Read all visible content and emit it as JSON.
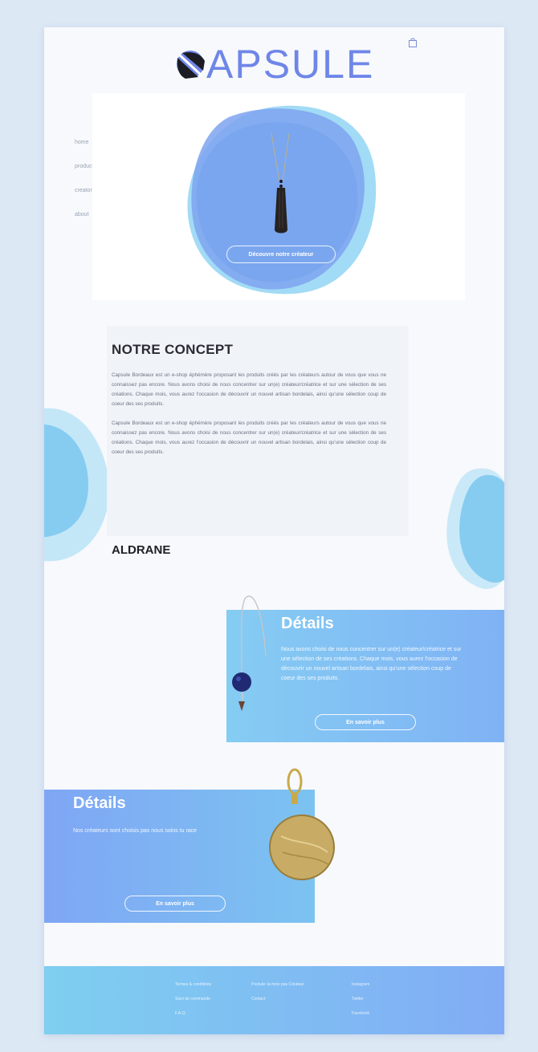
{
  "header": {
    "logo_text": "APSULE",
    "logo_letter": "C",
    "cart_icon": "shopping-bag-icon"
  },
  "nav": {
    "items": [
      {
        "label": "home"
      },
      {
        "label": "products"
      },
      {
        "label": "creators"
      },
      {
        "label": "about"
      }
    ]
  },
  "hero": {
    "button_label": "Découvre notre créateur"
  },
  "concept": {
    "title": "NOTRE CONCEPT",
    "paragraphs": [
      "Capsule Bordeaux est un e-shop éphémère proposant les produits créés par les créateurs autour de vous que vous ne connaissez pas encore. Nous avons choisi de nous concentrer sur un(e) créateur/créatrice et sur une sélection de ses créations. Chaque mois, vous aurez l'occasion de découvrir un nouvel artisan bordelais, ainsi qu'une sélection coup de coeur des ses produits.",
      "Capsule Bordeaux est un e-shop éphémère proposant les produits créés par les créateurs autour de vous que vous ne connaissez pas encore. Nous avons choisi de nous concentrer sur un(e) créateur/créatrice et sur une sélection de ses créations. Chaque mois, vous aurez l'occasion de découvrir un nouvel artisan bordelais, ainsi qu'une sélection coup de coeur des ses produits."
    ]
  },
  "creator": {
    "name": "ALDRANE"
  },
  "card1": {
    "title": "Détails",
    "text": "Nous avons choisi de nous concentrer sur un(e) créateur/créatrice et sur une sélection de ses créations. Chaque mois, vous aurez l'occasion de découvrir un nouvel artisan bordelais, ainsi qu'une sélection coup de coeur des ses produits.",
    "button_label": "En savoir plus"
  },
  "card2": {
    "title": "Détails",
    "text": "Nos créateurs sont choisis pas nous soins tu race",
    "button_label": "En savoir plus"
  },
  "footer": {
    "col1": [
      "Termes & conditions",
      "Suivi de commande",
      "F.A.Q."
    ],
    "col2": [
      "Postuler la mois pas Créateur",
      "Contact"
    ],
    "col3": [
      "Instagram",
      "Twitter",
      "Facebook"
    ]
  },
  "colors": {
    "accent": "#6f86e8",
    "blob_light": "#86d0f2",
    "blob_blue": "#7ea3f0",
    "footer_start": "#7ecff0",
    "footer_end": "#81acf5"
  }
}
